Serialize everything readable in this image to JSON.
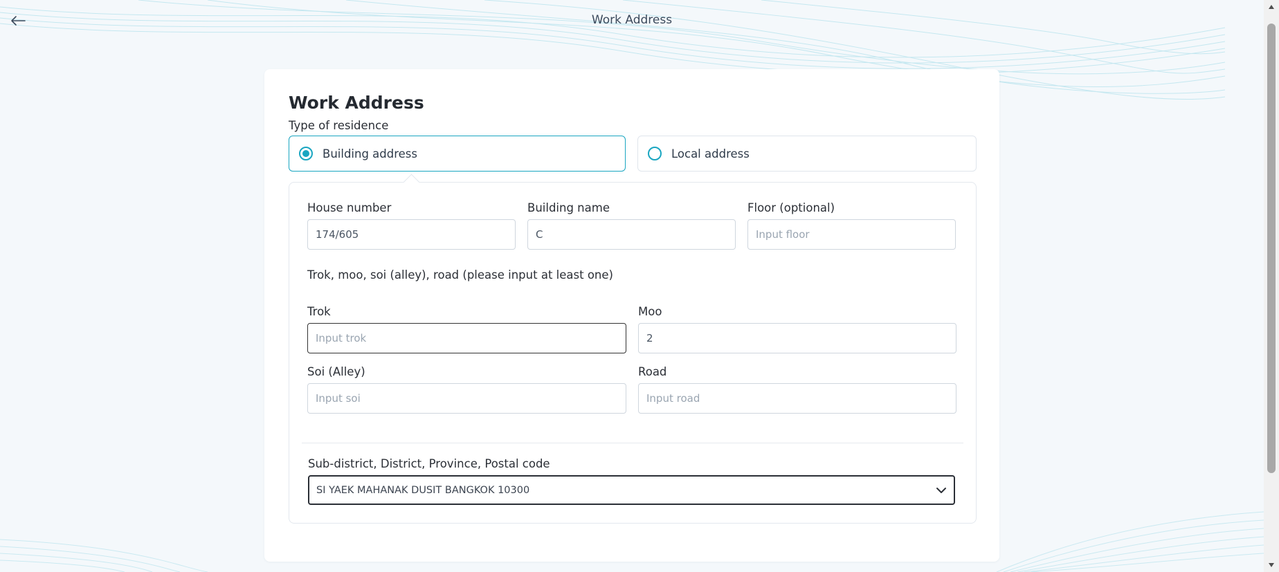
{
  "topbar": {
    "title": "Work Address",
    "back_icon": "arrow-left-icon"
  },
  "form": {
    "title": "Work Address",
    "residence_type_label": "Type of residence",
    "residence_options": [
      {
        "label": "Building address",
        "selected": true
      },
      {
        "label": "Local address",
        "selected": false
      }
    ],
    "house_number": {
      "label": "House number",
      "value": "174/605",
      "placeholder": ""
    },
    "building_name": {
      "label": "Building name",
      "value": "C",
      "placeholder": ""
    },
    "floor": {
      "label": "Floor (optional)",
      "value": "",
      "placeholder": "Input floor"
    },
    "road_note": "Trok, moo, soi (alley), road (please input at least one)",
    "trok": {
      "label": "Trok",
      "value": "",
      "placeholder": "Input trok"
    },
    "moo": {
      "label": "Moo",
      "value": "2",
      "placeholder": ""
    },
    "soi": {
      "label": "Soi (Alley)",
      "value": "",
      "placeholder": "Input soi"
    },
    "road": {
      "label": "Road",
      "value": "",
      "placeholder": "Input road"
    },
    "location": {
      "label": "Sub-district, District, Province, Postal code",
      "value": "SI YAEK MAHANAK DUSIT BANGKOK 10300",
      "icon": "chevron-down-icon"
    }
  },
  "colors": {
    "accent": "#1aa6c1",
    "background": "#f4f8fb",
    "card": "#ffffff",
    "border": "#cfd6de"
  }
}
